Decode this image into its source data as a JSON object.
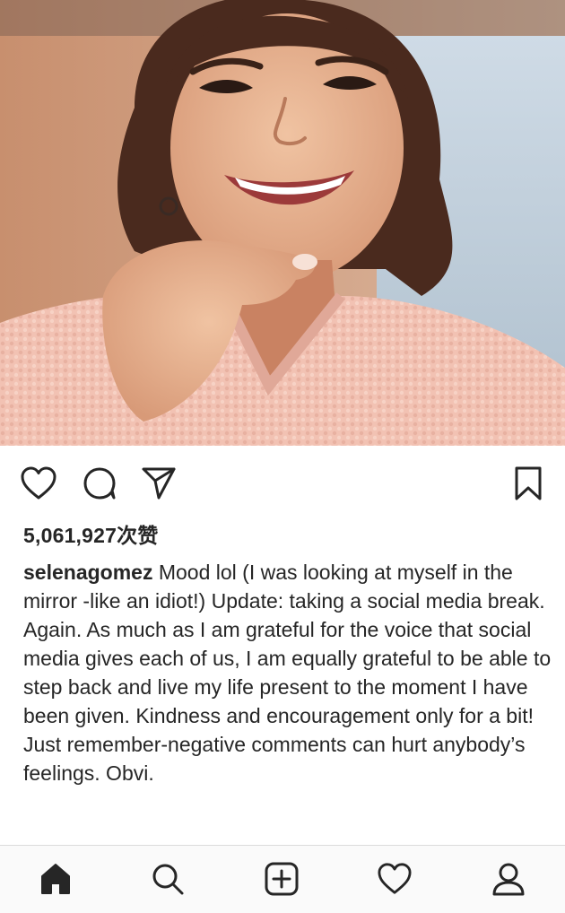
{
  "post": {
    "likes_text": "5,061,927次赞",
    "username": "selenagomez",
    "caption_text": "Mood lol (I was looking at myself in the mirror -like an idiot!) Update: taking a social media break. Again. As much as I am grateful for the voice that social media gives each of us, I am equally grateful to be able to step back and live my life present to the moment I have been given. Kindness and encouragement only for a bit! Just remember-negative comments can hurt anybody’s feelings. Obvi."
  },
  "icons": {
    "like": "heart-outline-icon",
    "comment": "comment-bubble-icon",
    "share": "paper-plane-icon",
    "save": "bookmark-icon",
    "home": "home-filled-icon",
    "search": "search-icon",
    "new_post": "plus-square-icon",
    "activity": "heart-outline-icon",
    "profile": "person-icon"
  },
  "colors": {
    "text": "#262626",
    "nav_background": "#fafafa",
    "divider": "#dbdbdb"
  }
}
